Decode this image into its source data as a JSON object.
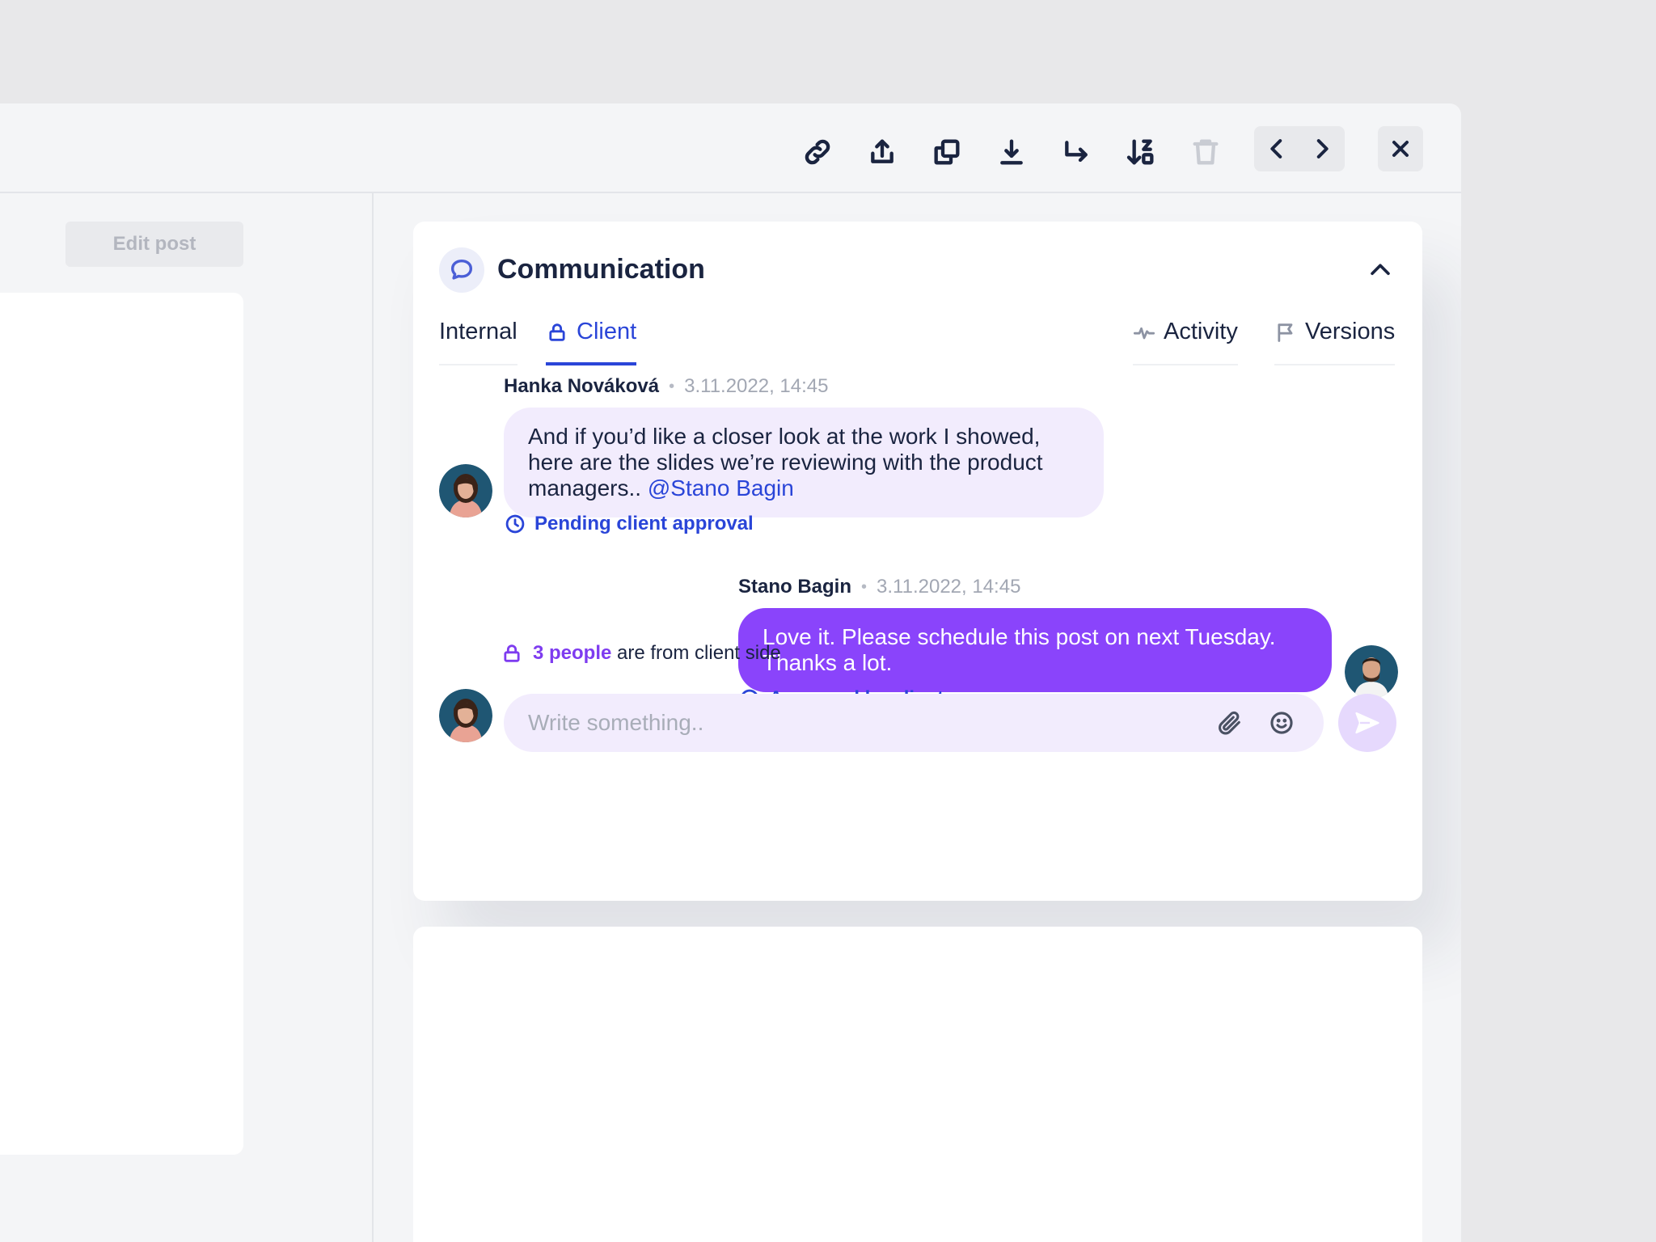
{
  "toolbar": {
    "icons": [
      "link-icon",
      "share-icon",
      "duplicate-icon",
      "download-icon",
      "forward-icon",
      "sort-icon",
      "trash-icon",
      "chevron-left-icon",
      "chevron-right-icon",
      "close-icon"
    ]
  },
  "left": {
    "edit_post_label": "Edit post"
  },
  "communication": {
    "title": "Communication",
    "tabs": [
      {
        "label": "Internal"
      },
      {
        "label": "Client"
      },
      {
        "label": "Activity"
      },
      {
        "label": "Versions"
      }
    ],
    "messages": [
      {
        "author": "Hanka Nováková",
        "time": "3.11.2022, 14:45",
        "text": "And if you’d like a closer look at the work I showed, here are the slides we’re reviewing with the product managers..",
        "mention": "@Stano Bagin",
        "status": "Pending client approval"
      },
      {
        "author": "Stano Bagin",
        "time": "3.11.2022, 14:45",
        "text": "Love it. Please schedule this post on next Tuesday. Thanks a lot.",
        "status": "Approved by client"
      }
    ],
    "people_note": {
      "highlight": "3 people",
      "rest": "are from client side"
    },
    "composer": {
      "placeholder": "Write something.."
    }
  },
  "colors": {
    "accent": "#2a45d8",
    "bubble_out": "#8a44fb",
    "bubble_in": "#f2ecfd"
  }
}
